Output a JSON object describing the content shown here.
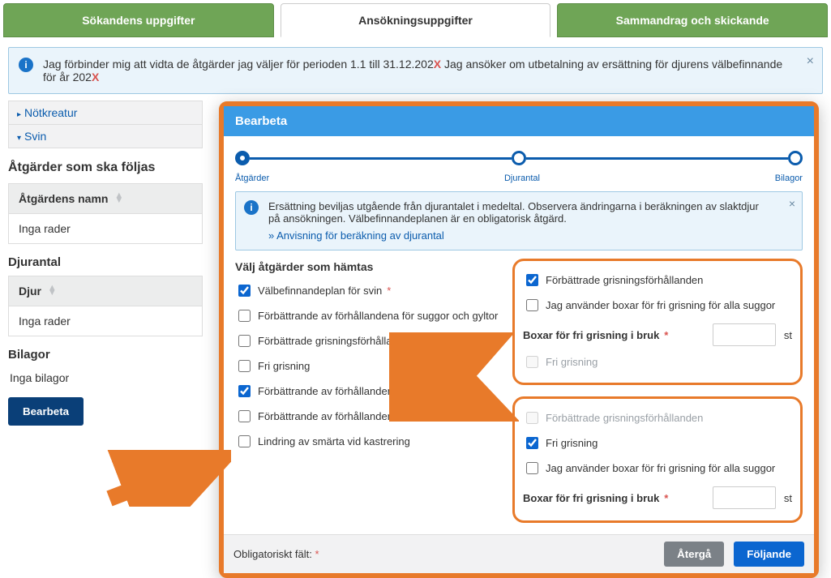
{
  "tabs": {
    "applicant": "Sökandens uppgifter",
    "application": "Ansökningsuppgifter",
    "summary": "Sammandrag och skickande"
  },
  "info_main": {
    "text_prefix": "Jag förbinder mig att vidta de åtgärder jag väljer för perioden 1.1 till 31.12.202",
    "text_suffix": " Jag ansöker om utbetalning av ersättning för djurens välbefinnande för år 202",
    "x": "X"
  },
  "left": {
    "cattle": "Nötkreatur",
    "swine": "Svin",
    "actions_h": "Åtgärder som ska följas",
    "col_action": "Åtgärdens namn",
    "no_rows": "Inga rader",
    "animals_h": "Djurantal",
    "col_animal": "Djur",
    "attachments_h": "Bilagor",
    "no_attachments": "Inga bilagor",
    "edit": "Bearbeta"
  },
  "modal": {
    "title": "Bearbeta",
    "steps": {
      "a": "Åtgärder",
      "b": "Djurantal",
      "c": "Bilagor"
    },
    "info_text": "Ersättning beviljas utgående från djurantalet i medeltal. Observera ändringarna i beräkningen av slaktdjur på ansökningen. Välbefinnandeplanen är en obligatorisk åtgärd.",
    "info_link": "» Anvisning för beräkning av djurantal",
    "choose_h": "Välj åtgärder som hämtas",
    "opts": [
      "Välbefinnandeplan för svin",
      "Förbättrande av förhållandena för suggor och gyltor",
      "Förbättrade grisningsförhållanden",
      "Fri grisning",
      "Förbättrande av förhållandena för avvanda grisar",
      "Förbättrande av förhållandena för slaktsvin",
      "Lindring av smärta vid kastrering"
    ],
    "r1": {
      "a": "Förbättrade grisningsförhållanden",
      "b": "Jag använder boxar för fri grisning för alla suggor",
      "c": "Boxar för fri grisning i bruk",
      "d": "Fri grisning"
    },
    "r2": {
      "a": "Förbättrade grisningsförhållanden",
      "b": "Fri grisning",
      "c": "Jag använder boxar för fri grisning för alla suggor",
      "d": "Boxar för fri grisning i bruk"
    },
    "unit": "st",
    "oblig": "Obligatoriskt fält:",
    "back": "Återgå",
    "next": "Följande"
  }
}
